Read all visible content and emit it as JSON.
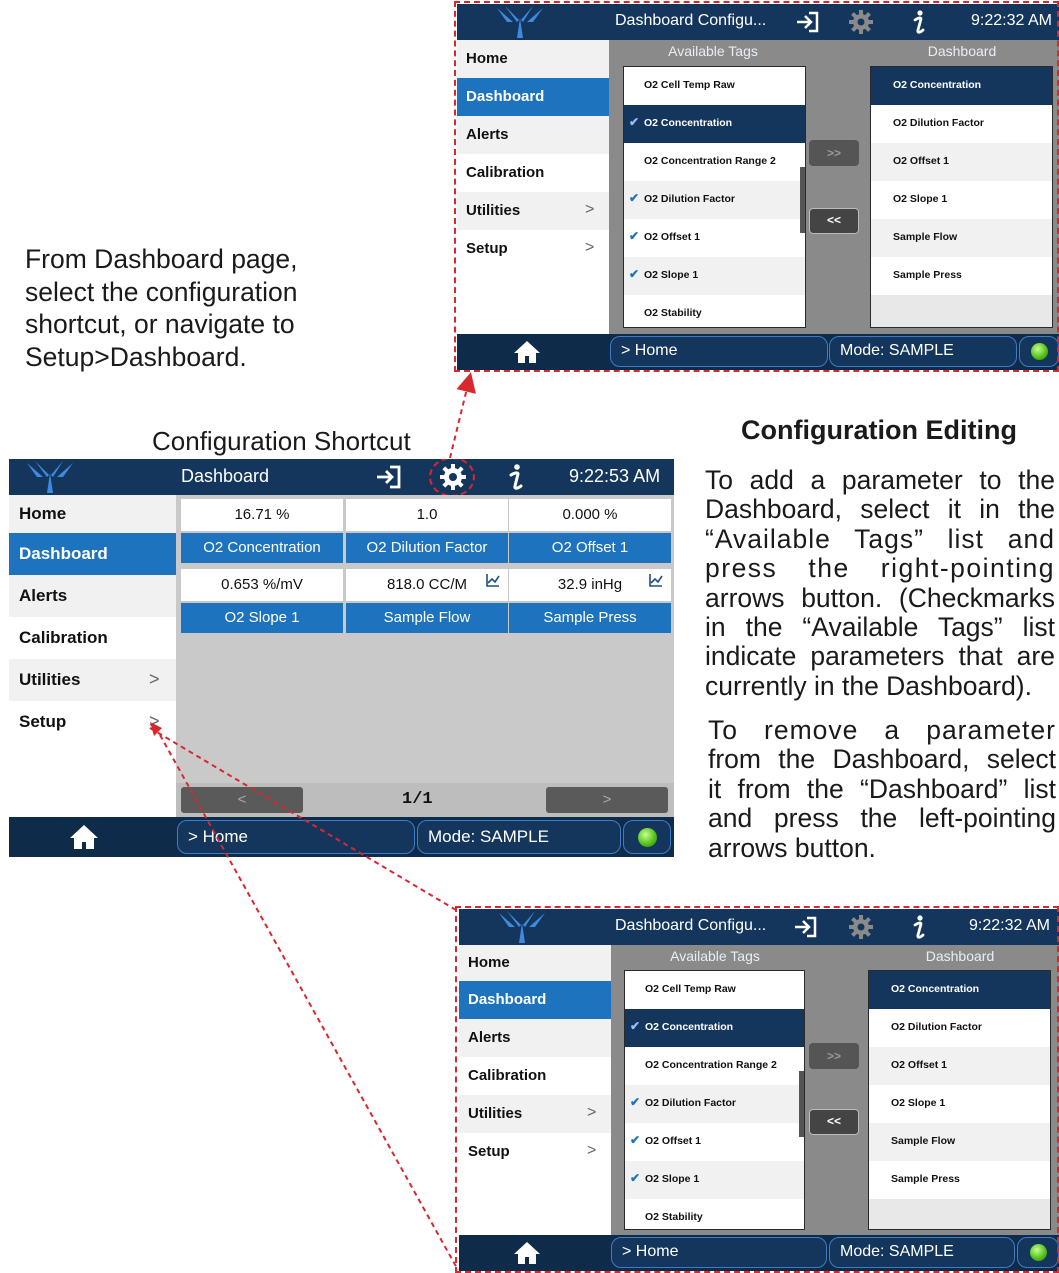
{
  "instructions": {
    "left_caption": [
      "From Dashboard page,",
      "select the configuration",
      "shortcut, or navigate to",
      "Setup>Dashboard."
    ],
    "shortcut_label": "Configuration Shortcut",
    "heading": "Configuration Editing",
    "add_text": [
      "To add a parameter to the",
      "Dashboard, select it in the",
      "“Available Tags” list and",
      "press the right-pointing",
      "arrows button. (Checkmarks",
      "in the “Available Tags” list",
      "indicate parameters that are",
      "currently in the Dashboard)."
    ],
    "remove_text": [
      "To remove a parameter",
      "from the Dashboard, select",
      "it from the “Dashboard” list",
      "and press the left-pointing",
      "arrows button."
    ]
  },
  "config_screen": {
    "title": "Dashboard Configu...",
    "time": "9:22:32 AM",
    "available_header": "Available Tags",
    "dashboard_header": "Dashboard",
    "nav": [
      {
        "label": "Home",
        "chevron": ""
      },
      {
        "label": "Dashboard",
        "chevron": ""
      },
      {
        "label": "Alerts",
        "chevron": ""
      },
      {
        "label": "Calibration",
        "chevron": ""
      },
      {
        "label": "Utilities",
        "chevron": ">"
      },
      {
        "label": "Setup",
        "chevron": ">"
      }
    ],
    "available_tags": [
      {
        "label": "O2 Cell Temp Raw",
        "checked": false
      },
      {
        "label": "O2 Concentration",
        "checked": true
      },
      {
        "label": "O2 Concentration Range 2",
        "checked": false
      },
      {
        "label": "O2 Dilution Factor",
        "checked": true
      },
      {
        "label": "O2 Offset 1",
        "checked": true
      },
      {
        "label": "O2 Slope 1",
        "checked": true
      },
      {
        "label": "O2 Stability",
        "checked": false
      }
    ],
    "dashboard_tags": [
      "O2 Concentration",
      "O2 Dilution Factor",
      "O2 Offset 1",
      "O2 Slope 1",
      "Sample Flow",
      "Sample Press"
    ],
    "add_button": ">>",
    "remove_button": "<<",
    "breadcrumb": "> Home",
    "mode": "Mode: SAMPLE"
  },
  "main_screen": {
    "title": "Dashboard",
    "time": "9:22:53 AM",
    "nav": [
      {
        "label": "Home",
        "chevron": ""
      },
      {
        "label": "Dashboard",
        "chevron": ""
      },
      {
        "label": "Alerts",
        "chevron": ""
      },
      {
        "label": "Calibration",
        "chevron": ""
      },
      {
        "label": "Utilities",
        "chevron": ">"
      },
      {
        "label": "Setup",
        "chevron": ">"
      }
    ],
    "tiles": [
      {
        "value": "16.71 %",
        "label": "O2 Concentration",
        "trend": false
      },
      {
        "value": "1.0",
        "label": "O2 Dilution Factor",
        "trend": false
      },
      {
        "value": "0.000 %",
        "label": "O2 Offset 1",
        "trend": false
      },
      {
        "value": "0.653 %/mV",
        "label": "O2 Slope 1",
        "trend": false
      },
      {
        "value": "818.0 CC/M",
        "label": "Sample Flow",
        "trend": true
      },
      {
        "value": "32.9 inHg",
        "label": "Sample Press",
        "trend": true
      }
    ],
    "page_indicator": "1/1",
    "prev_button": "<",
    "next_button": ">",
    "breadcrumb": "> Home",
    "mode": "Mode: SAMPLE"
  },
  "colors": {
    "annotation": "#d9272e",
    "nav_active": "#1e73be",
    "bar": "#14365c",
    "status_led": "#55c21f"
  }
}
